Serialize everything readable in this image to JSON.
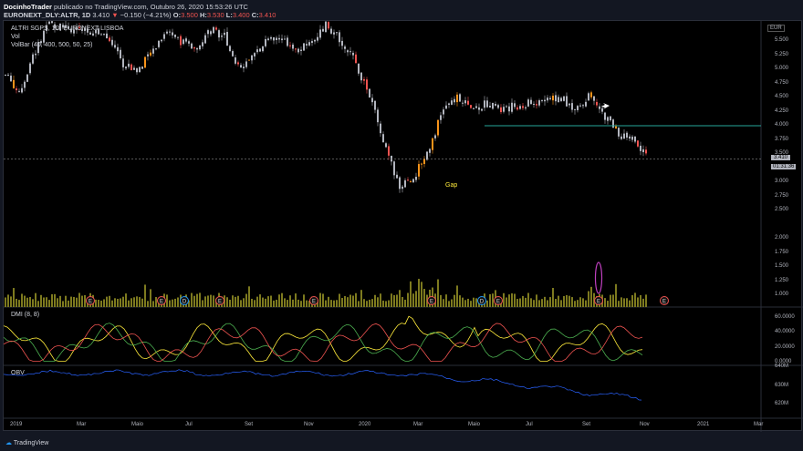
{
  "header": {
    "author": "DocinhoTrader",
    "published": "publicado no TradingView.com, Outubro 26, 2020 15:53:26 UTC",
    "symbol": "EURONEXT_DLY:ALTR, 1D",
    "last": "3.410",
    "arrow": "▼",
    "change": "−0.150 (−4.21%)",
    "o_label": "O:",
    "o": "3.500",
    "h_label": "H:",
    "h": "3.530",
    "l_label": "L:",
    "l": "3.400",
    "c_label": "C:",
    "c": "3.410"
  },
  "legend": {
    "title": "ALTRI SGPS, 1D, EURONEXT LISBOA",
    "vol": "Vol",
    "volbar": "VolBar (40, 400, 500, 50, 25)",
    "dmi": "DMI (8, 8)",
    "obv": "OBV"
  },
  "price_axis": {
    "currency": "EUR",
    "ticks": [
      "5.500",
      "5.250",
      "5.000",
      "4.750",
      "4.500",
      "4.250",
      "4.000",
      "3.750",
      "3.500",
      "3.000",
      "2.750",
      "2.500",
      "2.000",
      "1.750",
      "1.500",
      "1.250",
      "1.000"
    ],
    "last_price": "3.410",
    "countdown": "01:31:36"
  },
  "dmi_axis": [
    "60.0000",
    "40.0000",
    "20.0000",
    "0.0000"
  ],
  "obv_axis": [
    "640M",
    "630M",
    "620M"
  ],
  "time_axis": [
    "2019",
    "Mar",
    "Maio",
    "Jul",
    "Set",
    "Nov",
    "2020",
    "Mar",
    "Maio",
    "Jul",
    "Set",
    "Nov",
    "2021",
    "Mar"
  ],
  "annotation": {
    "gap": "Gap"
  },
  "events": [
    {
      "t": "E"
    },
    {
      "t": "E"
    },
    {
      "t": "D"
    },
    {
      "t": "E"
    },
    {
      "t": "E"
    },
    {
      "t": "E"
    },
    {
      "t": "D"
    },
    {
      "t": "E"
    },
    {
      "t": "E"
    },
    {
      "t": "E"
    }
  ],
  "colors": {
    "up": "#b2b5be",
    "down": "#b2b5be",
    "high_vol": "#f7931a",
    "vol": "#7d7a1f",
    "dmi_plus": "#4caf50",
    "dmi_minus": "#ef5350",
    "adx": "#ffeb3b",
    "obv": "#2962ff",
    "level": "#26a69a"
  },
  "footer": {
    "brand": "TradingView"
  },
  "chart_data": {
    "type": "candlestick",
    "price_path": [
      [
        0,
        4.9
      ],
      [
        1,
        4.6
      ],
      [
        2,
        5.3
      ],
      [
        3,
        5.8
      ],
      [
        5,
        5.7
      ],
      [
        7,
        5.6
      ],
      [
        8,
        5.1
      ],
      [
        9,
        4.95
      ],
      [
        10,
        5.3
      ],
      [
        11,
        5.7
      ],
      [
        12,
        5.5
      ],
      [
        13,
        5.4
      ],
      [
        14,
        5.7
      ],
      [
        15,
        5.6
      ],
      [
        16,
        5.0
      ],
      [
        17,
        5.2
      ],
      [
        18,
        5.6
      ],
      [
        19,
        5.5
      ],
      [
        20,
        5.3
      ],
      [
        21,
        5.5
      ],
      [
        22,
        5.8
      ],
      [
        23,
        5.5
      ],
      [
        24,
        5.1
      ],
      [
        25,
        4.5
      ],
      [
        26,
        3.6
      ],
      [
        27,
        2.9
      ],
      [
        28,
        3.1
      ],
      [
        29,
        3.6
      ],
      [
        30,
        4.3
      ],
      [
        31,
        4.5
      ],
      [
        32,
        4.3
      ],
      [
        33,
        4.4
      ],
      [
        34,
        4.3
      ],
      [
        36,
        4.4
      ],
      [
        38,
        4.5
      ],
      [
        39,
        4.3
      ],
      [
        40,
        4.55
      ],
      [
        41,
        4.2
      ],
      [
        42,
        3.85
      ],
      [
        43,
        3.75
      ],
      [
        44,
        3.41
      ]
    ],
    "level": 4.0,
    "last": 3.41
  }
}
